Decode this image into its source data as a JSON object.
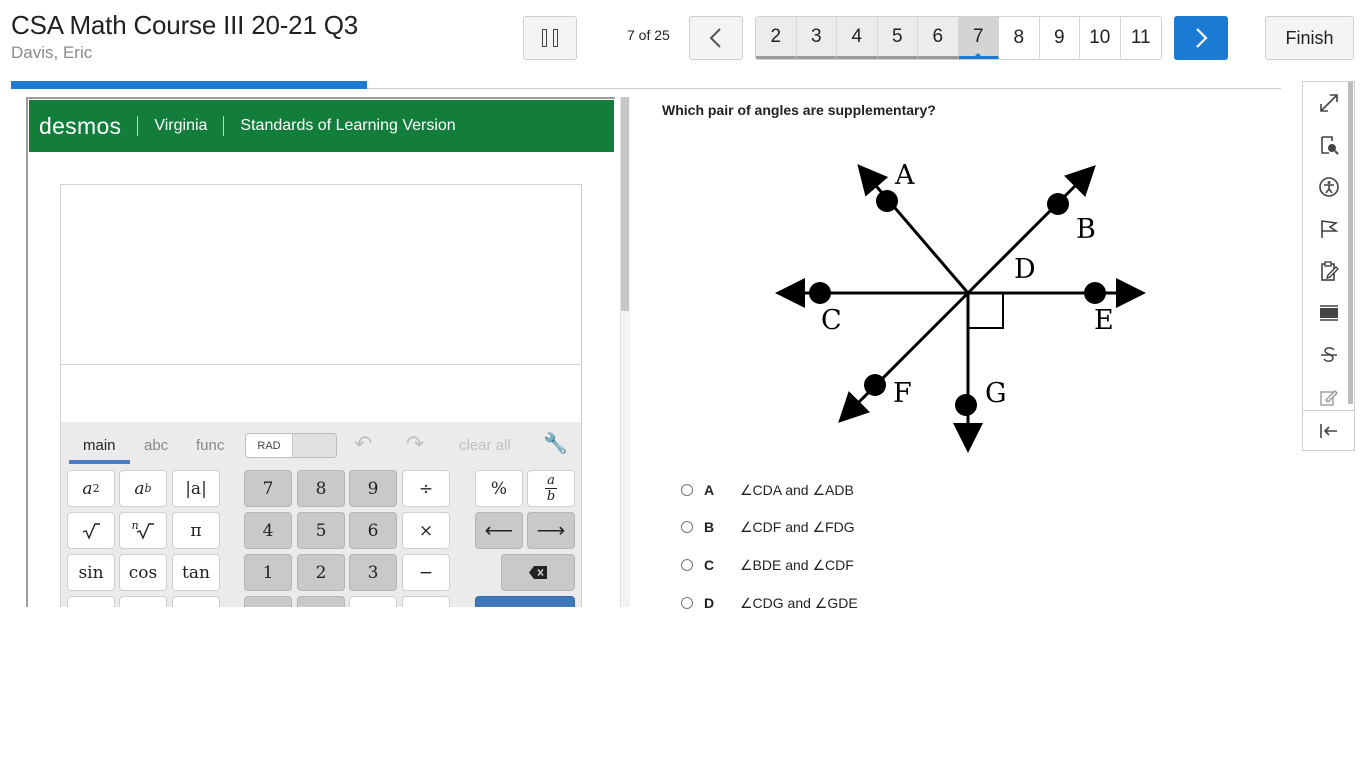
{
  "header": {
    "course_title": "CSA Math Course III 20-21 Q3",
    "student_name": "Davis, Eric",
    "progress_text": "7 of 25",
    "progress_fraction": 0.28,
    "finish_label": "Finish",
    "question_numbers": [
      "2",
      "3",
      "4",
      "5",
      "6",
      "7",
      "8",
      "9",
      "10",
      "11"
    ],
    "current_question": "7",
    "accent_color": "#1a7ad4"
  },
  "calculator": {
    "brand": "desmos",
    "region": "Virginia",
    "version": "Standards of Learning Version",
    "brand_color": "#137e3c",
    "tabs": {
      "main": "main",
      "abc": "abc",
      "func": "func"
    },
    "angle_mode": "RAD",
    "clear_all": "clear all",
    "keys": {
      "seven": "7",
      "eight": "8",
      "nine": "9",
      "divide": "÷",
      "percent": "%",
      "pi": "π",
      "four": "4",
      "five": "5",
      "six": "6",
      "times": "×",
      "sin": "sin",
      "cos": "cos",
      "tan": "tan",
      "one": "1",
      "two": "2",
      "three": "3",
      "minus": "−",
      "abs": "|a|",
      "a": "a",
      "b": "b",
      "n": "n",
      "sq_exp": "2"
    }
  },
  "question": {
    "text": "Which pair of angles are supplementary?",
    "diagram_labels": {
      "A": "A",
      "B": "B",
      "C": "C",
      "D": "D",
      "E": "E",
      "F": "F",
      "G": "G"
    },
    "choices": [
      {
        "letter": "A",
        "text": "∠CDA and ∠ADB"
      },
      {
        "letter": "B",
        "text": "∠CDF and ∠FDG"
      },
      {
        "letter": "C",
        "text": "∠BDE and ∠CDF"
      },
      {
        "letter": "D",
        "text": "∠CDG and ∠GDE"
      }
    ]
  },
  "toolbar_icons": [
    "expand-icon",
    "reference-icon",
    "accessibility-icon",
    "flag-icon",
    "notepad-icon",
    "line-reader-icon",
    "strikethrough-icon",
    "highlighter-icon",
    "collapse-icon"
  ]
}
